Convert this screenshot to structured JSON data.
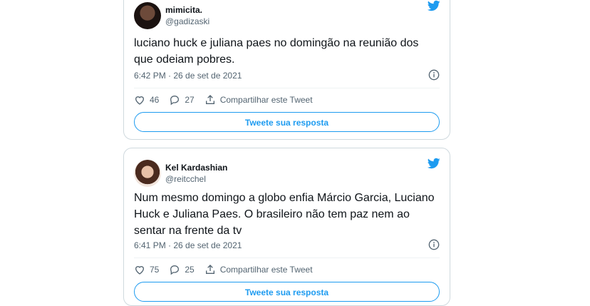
{
  "colors": {
    "accent": "#1d9bf0",
    "border": "#cfd9de",
    "muted": "#536471",
    "text": "#0f1419"
  },
  "tweets": [
    {
      "name": "mimicita.",
      "handle": "@gadizaski",
      "text": "luciano huck e juliana paes no domingão na reunião dos que odeiam pobres.",
      "time": "6:42 PM · 26 de set de 2021",
      "likes": "46",
      "replies": "27",
      "share_label": "Compartilhar este Tweet",
      "reply_button": "Tweete sua resposta"
    },
    {
      "name": "Kel Kardashian",
      "handle": "@reitcchel",
      "text": "Num mesmo domingo a globo enfia Márcio Garcia, Luciano Huck e Juliana Paes. O brasileiro não tem paz nem ao sentar na frente da tv",
      "time": "6:41 PM · 26 de set de 2021",
      "likes": "75",
      "replies": "25",
      "share_label": "Compartilhar este Tweet",
      "reply_button": "Tweete sua resposta"
    }
  ],
  "icons": [
    "twitter-bird-icon",
    "info-icon",
    "heart-icon",
    "reply-icon",
    "share-icon"
  ]
}
